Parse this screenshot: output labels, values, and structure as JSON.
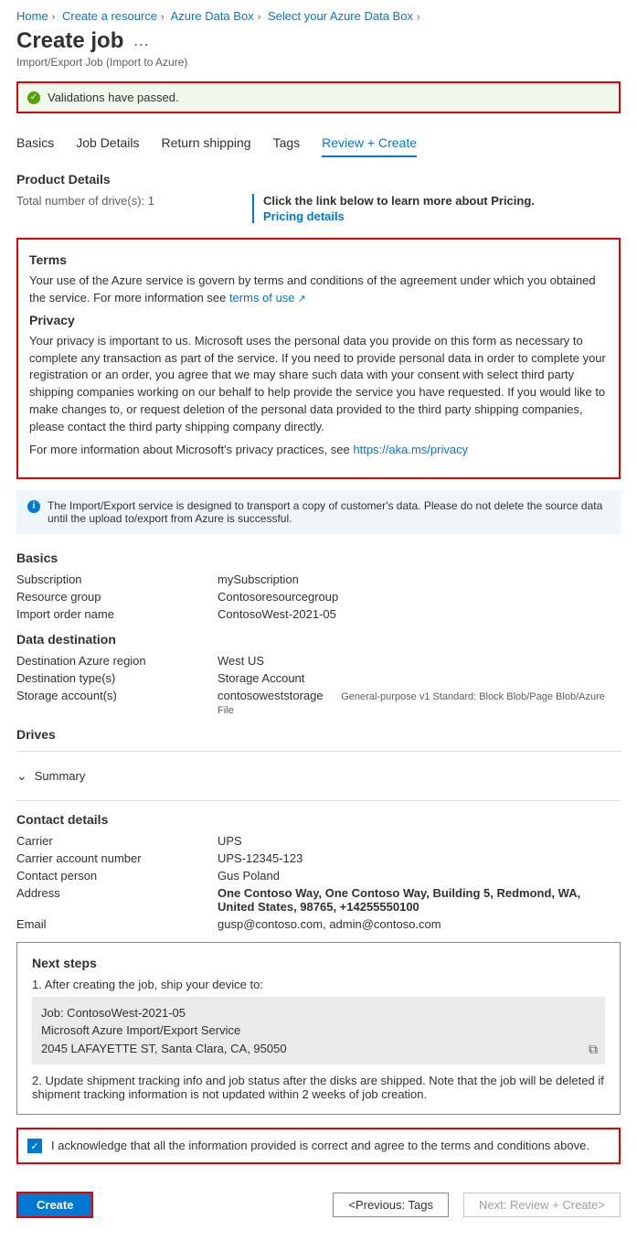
{
  "breadcrumb": [
    "Home",
    "Create a resource",
    "Azure Data Box",
    "Select your Azure Data Box"
  ],
  "title": "Create job",
  "subtitle": "Import/Export Job (Import to Azure)",
  "validation_message": "Validations have passed.",
  "tabs": [
    "Basics",
    "Job Details",
    "Return shipping",
    "Tags",
    "Review + Create"
  ],
  "product_details": {
    "heading": "Product Details",
    "drive_label": "Total number of drive(s): 1",
    "pricing_msg": "Click the link below to learn more about Pricing.",
    "pricing_link": "Pricing details"
  },
  "terms": {
    "heading": "Terms",
    "body": "Your use of the Azure service is govern by terms and conditions of the agreement under which you obtained the service. For more information see",
    "link": "terms of use"
  },
  "privacy": {
    "heading": "Privacy",
    "body1": "Your privacy is important to us. Microsoft uses the personal data you provide on this form as necessary to complete any transaction as part of the service. If you need to provide personal data in order to complete your registration or an order, you agree that we may share such data with your consent with select third party shipping companies working on our behalf to help provide the service you have requested. If you would like to make changes to, or request deletion of the personal data provided to the third party shipping companies, please contact the third party shipping company directly.",
    "body2_prefix": "For more information about Microsoft's privacy practices, see",
    "body2_link": "https://aka.ms/privacy"
  },
  "info_banner": "The Import/Export service is designed to transport a copy of customer's data. Please do not delete the source data until the upload to/export from Azure is successful.",
  "basics": {
    "heading": "Basics",
    "subscription_label": "Subscription",
    "subscription_value": "mySubscription",
    "rg_label": "Resource group",
    "rg_value": "Contosoresourcegroup",
    "order_label": "Import order name",
    "order_value": "ContosoWest-2021-05"
  },
  "destination": {
    "heading": "Data destination",
    "region_label": "Destination Azure region",
    "region_value": "West US",
    "type_label": "Destination type(s)",
    "type_value": "Storage Account",
    "storage_label": "Storage account(s)",
    "storage_value": "contosoweststorage",
    "storage_note": "General-purpose v1 Standard: Block Blob/Page Blob/Azure File"
  },
  "drives": {
    "heading": "Drives",
    "summary": "Summary"
  },
  "contact": {
    "heading": "Contact details",
    "carrier_label": "Carrier",
    "carrier_value": "UPS",
    "acct_label": "Carrier account number",
    "acct_value": "UPS-12345-123",
    "person_label": "Contact person",
    "person_value": "Gus Poland",
    "addr_label": "Address",
    "addr_value": "One Contoso Way, One Contoso Way, Building 5, Redmond, WA, United States, 98765, +14255550100",
    "email_label": "Email",
    "email_value": "gusp@contoso.com, admin@contoso.com"
  },
  "next_steps": {
    "heading": "Next steps",
    "step1": "1. After creating the job, ship your device to:",
    "ship_line1": "Job: ContosoWest-2021-05",
    "ship_line2": "Microsoft Azure Import/Export Service",
    "ship_line3": "2045 LAFAYETTE ST, Santa Clara, CA, 95050",
    "step2": "2. Update shipment tracking info and job status after the disks are shipped. Note that the job will be deleted if shipment tracking information is not updated within 2 weeks of job creation."
  },
  "ack_text": "I acknowledge that all the information provided is correct and agree to the terms and conditions above.",
  "buttons": {
    "create": "Create",
    "prev": "<Previous: Tags",
    "next": "Next: Review + Create>"
  }
}
